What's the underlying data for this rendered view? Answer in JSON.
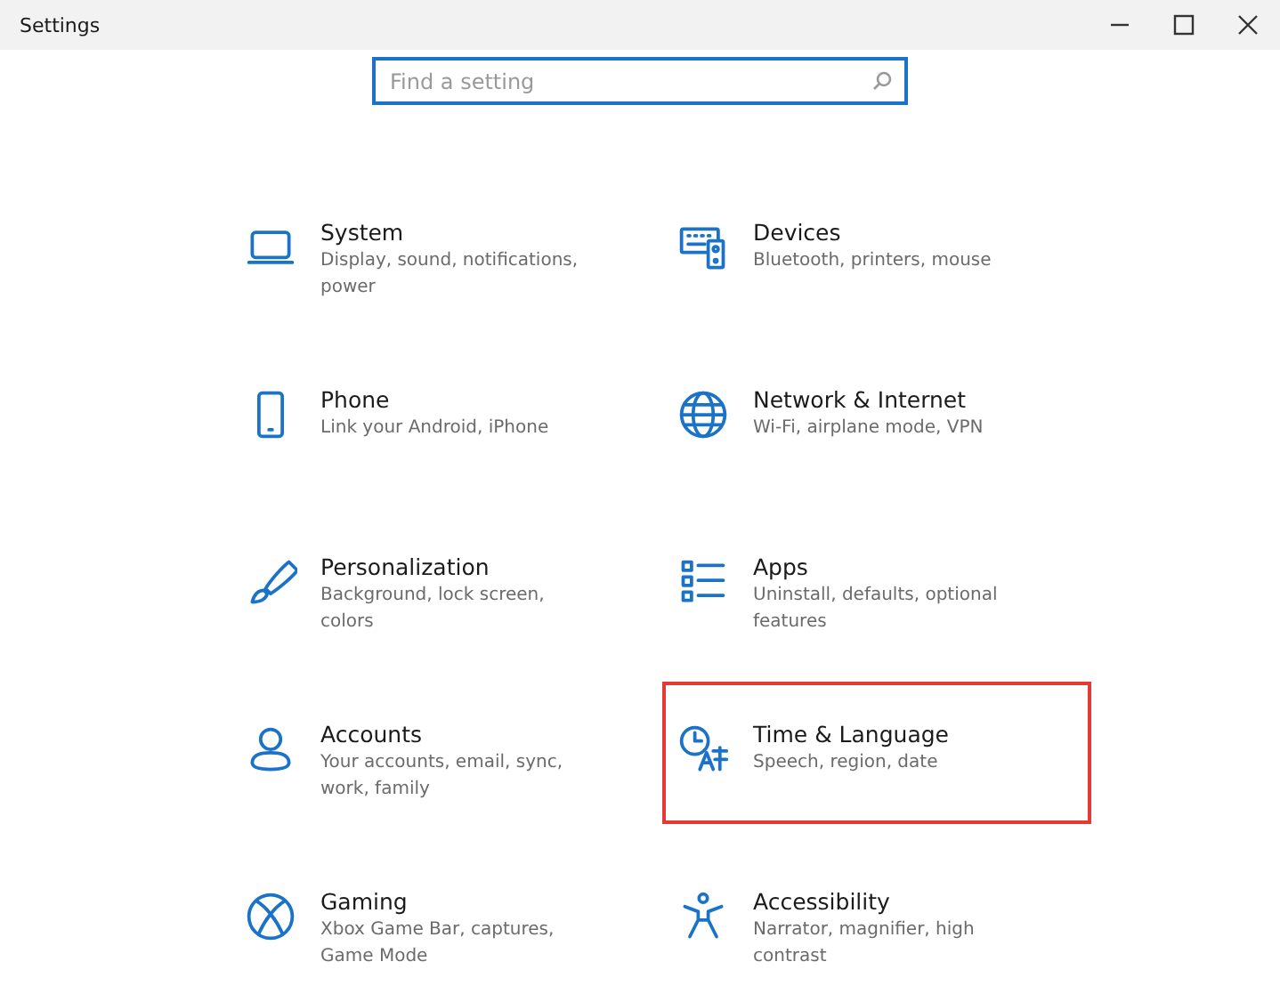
{
  "window": {
    "title": "Settings"
  },
  "search": {
    "placeholder": "Find a setting"
  },
  "categories": [
    {
      "title": "System",
      "description": "Display, sound, notifications, power",
      "highlighted": false
    },
    {
      "title": "Devices",
      "description": "Bluetooth, printers, mouse",
      "highlighted": false
    },
    {
      "title": "Phone",
      "description": "Link your Android, iPhone",
      "highlighted": false
    },
    {
      "title": "Network & Internet",
      "description": "Wi-Fi, airplane mode, VPN",
      "highlighted": false
    },
    {
      "title": "Personalization",
      "description": "Background, lock screen, colors",
      "highlighted": false
    },
    {
      "title": "Apps",
      "description": "Uninstall, defaults, optional features",
      "highlighted": false
    },
    {
      "title": "Accounts",
      "description": "Your accounts, email, sync, work, family",
      "highlighted": false
    },
    {
      "title": "Time & Language",
      "description": "Speech, region, date",
      "highlighted": true
    },
    {
      "title": "Gaming",
      "description": "Xbox Game Bar, captures, Game Mode",
      "highlighted": false
    },
    {
      "title": "Accessibility",
      "description": "Narrator, magnifier, high contrast",
      "highlighted": false
    }
  ]
}
